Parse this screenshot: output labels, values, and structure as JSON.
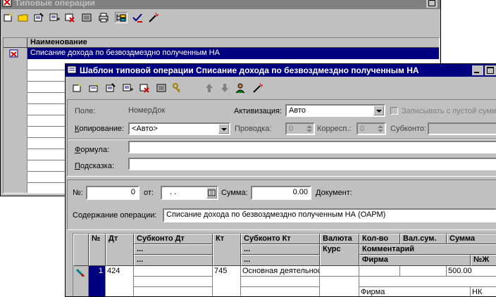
{
  "back_window": {
    "title": "Типовые операции",
    "header": {
      "name_col": "Наименование"
    },
    "rows": [
      "Списание дохода по безвоздмездно полученным НА"
    ],
    "toolbar_icons": [
      "new-icon",
      "folder-icon",
      "edit-icon",
      "copy-icon",
      "delete-icon",
      "properties-icon",
      "print-icon",
      "tree-view-icon",
      "checkmark-icon",
      "magic-wand-icon"
    ]
  },
  "front_window": {
    "title": "Шаблон типовой операции Списание дохода по безвоздмездно полученным НА",
    "toolbar_icons": [
      "new-icon",
      "insert-icon",
      "edit-icon",
      "copy-icon",
      "delete-icon",
      "properties-icon",
      "key-icon",
      "arrow-up-icon",
      "arrow-down-icon",
      "user-icon",
      "magic-wand-icon"
    ],
    "form": {
      "pole_label": "Поле:",
      "pole_value": "НомерДок",
      "activation_label": "Активизация:",
      "activation_value": "Авто",
      "save_empty_label": "Записывать с пустой сумм",
      "copy_label": "Копирование:",
      "copy_value": "<Авто>",
      "provodka_label": "Проводка:",
      "provodka_value": "0",
      "corresp_label": "Корресп.:",
      "corresp_value": "0",
      "subkonto_label": "Субконто:",
      "formula_label": "Формула:",
      "hint_label": "Подсказка:"
    },
    "doc": {
      "number_label": "№:",
      "number_value": "0",
      "date_label": "от:",
      "date_value": ". .",
      "sum_label": "Сумма:",
      "sum_value": "0.00",
      "document_label": "Документ:",
      "content_label": "Содержание операции:",
      "content_value": "Списание дохода по безвоздмездно полученным НА (ОАРМ)"
    },
    "table": {
      "headers": {
        "num": "№",
        "dt": "Дт",
        "subkonto_dt": "Субконто Дт",
        "kt": "Кт",
        "subkonto_kt": "Субконто Кт",
        "currency": "Валюта",
        "rate": "Курс",
        "qty": "Кол-во",
        "cur_sum": "Вал.сум.",
        "sum": "Сумма",
        "comment": "Комментарий",
        "firm": "Фирма",
        "nj": "№Ж",
        "ellipsis": "..."
      },
      "row": {
        "num": "1",
        "dt": "424",
        "kt": "745",
        "subkonto_kt": "Основная деятельность",
        "sum": "500.00",
        "firm": "Фирма",
        "nj": "НК"
      }
    }
  }
}
